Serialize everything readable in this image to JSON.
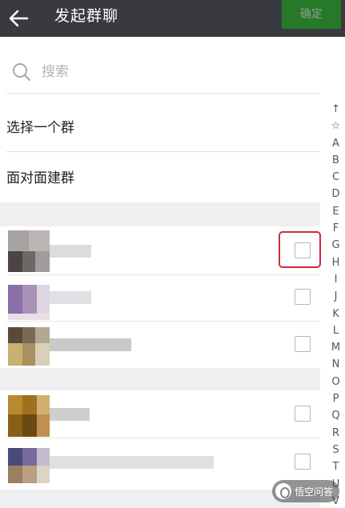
{
  "header": {
    "title": "发起群聊",
    "confirm_label": "确定",
    "back_icon": "arrow-left-icon",
    "background": "#393a3f",
    "confirm_color": "#1aad19"
  },
  "search": {
    "placeholder": "搜索",
    "icon": "search-icon"
  },
  "options": [
    {
      "label": "选择一个群"
    },
    {
      "label": "面对面建群"
    }
  ],
  "contacts": [
    {
      "checked": false,
      "highlighted": true
    },
    {
      "checked": false,
      "highlighted": false
    },
    {
      "checked": false,
      "highlighted": false
    },
    {
      "checked": false,
      "highlighted": false
    },
    {
      "checked": false,
      "highlighted": false
    }
  ],
  "alphabet_index": [
    "↑",
    "☆",
    "A",
    "B",
    "C",
    "D",
    "E",
    "F",
    "G",
    "H",
    "I",
    "J",
    "K",
    "L",
    "M",
    "N",
    "O",
    "P",
    "Q",
    "R",
    "S",
    "T",
    "U",
    "V"
  ],
  "watermark": {
    "text": "悟空问答",
    "highlight_color": "#d02a36"
  }
}
